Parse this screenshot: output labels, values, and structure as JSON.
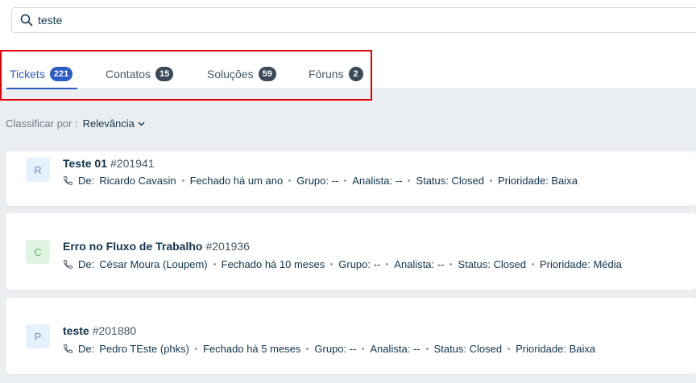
{
  "search": {
    "value": "teste"
  },
  "tabs": [
    {
      "label": "Tickets",
      "count": "221",
      "active": true
    },
    {
      "label": "Contatos",
      "count": "15",
      "active": false
    },
    {
      "label": "Soluções",
      "count": "59",
      "active": false
    },
    {
      "label": "Fóruns",
      "count": "2",
      "active": false
    }
  ],
  "sort": {
    "label": "Classificar por :",
    "value": "Relevância"
  },
  "results": [
    {
      "initial": "R",
      "avatar_bg": "#e5f2fd",
      "avatar_fg": "#6b93c7",
      "title": "Teste 01",
      "id": "#201941",
      "from_label": "De:",
      "from": "Ricardo Cavasin",
      "closed": "Fechado há um ano",
      "group": "Grupo: --",
      "agent": "Analista: --",
      "status": "Status: Closed",
      "priority": "Prioridade: Baixa"
    },
    {
      "initial": "C",
      "avatar_bg": "#e0f5e1",
      "avatar_fg": "#67b36b",
      "title": "Erro no Fluxo de Trabalho",
      "id": "#201936",
      "from_label": "De:",
      "from": "César Moura (Loupem)",
      "closed": "Fechado há 10 meses",
      "group": "Grupo: --",
      "agent": "Analista: --",
      "status": "Status: Closed",
      "priority": "Prioridade: Média"
    },
    {
      "initial": "P",
      "avatar_bg": "#e5f2fd",
      "avatar_fg": "#6b93c7",
      "title": "teste",
      "id": "#201880",
      "from_label": "De:",
      "from": "Pedro TEste (phks)",
      "closed": "Fechado há 5 meses",
      "group": "Grupo: --",
      "agent": "Analista: --",
      "status": "Status: Closed",
      "priority": "Prioridade: Baixa"
    }
  ],
  "colors": {
    "accent": "#2c5cc5",
    "highlight_border": "#e00000",
    "badge": "#3c4a57"
  }
}
